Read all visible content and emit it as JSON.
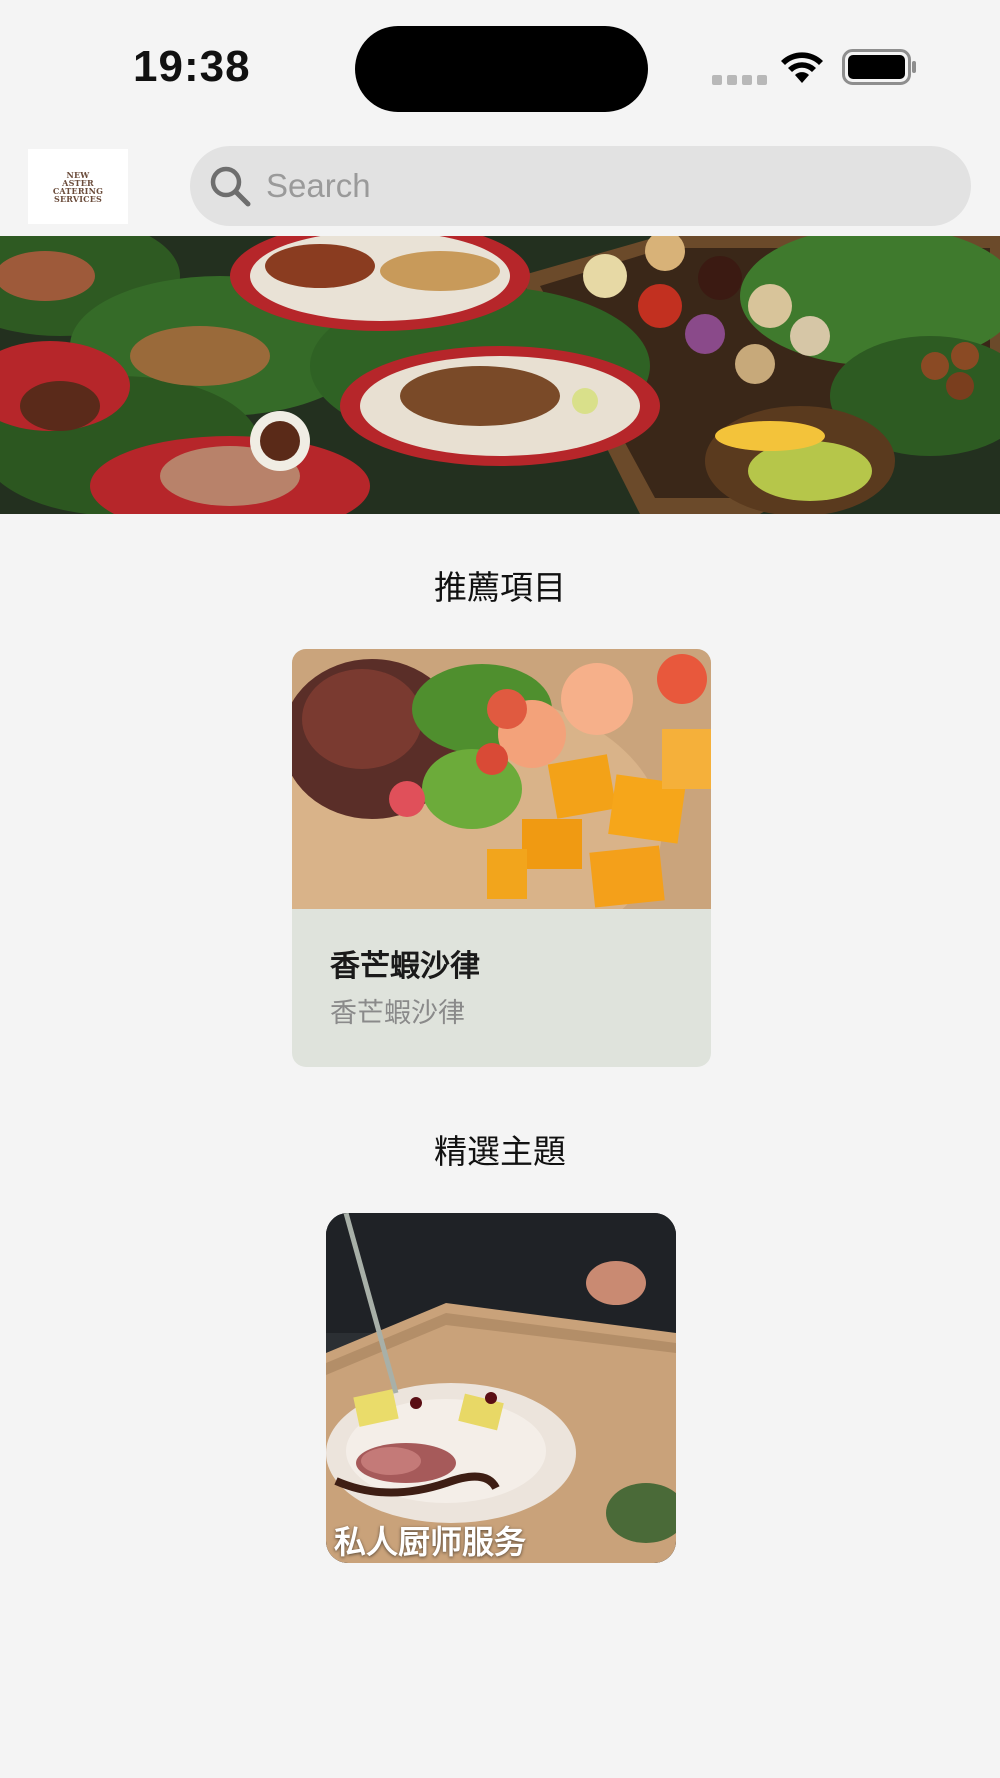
{
  "status_bar": {
    "time": "19:38"
  },
  "header": {
    "logo_text": [
      "NEW",
      "ASTER",
      "CATERING",
      "SERVICES"
    ],
    "search_placeholder": "Search"
  },
  "sections": {
    "recommended_title": "推薦項目",
    "featured_title": "精選主題"
  },
  "recommended": [
    {
      "name": "香芒蝦沙律",
      "subtitle": "香芒蝦沙律"
    }
  ],
  "featured": [
    {
      "label": "私人厨师服务"
    }
  ],
  "colors": {
    "background": "#f4f4f4",
    "search_bg": "#e2e2e2",
    "card_bg": "#dfe3dc"
  }
}
